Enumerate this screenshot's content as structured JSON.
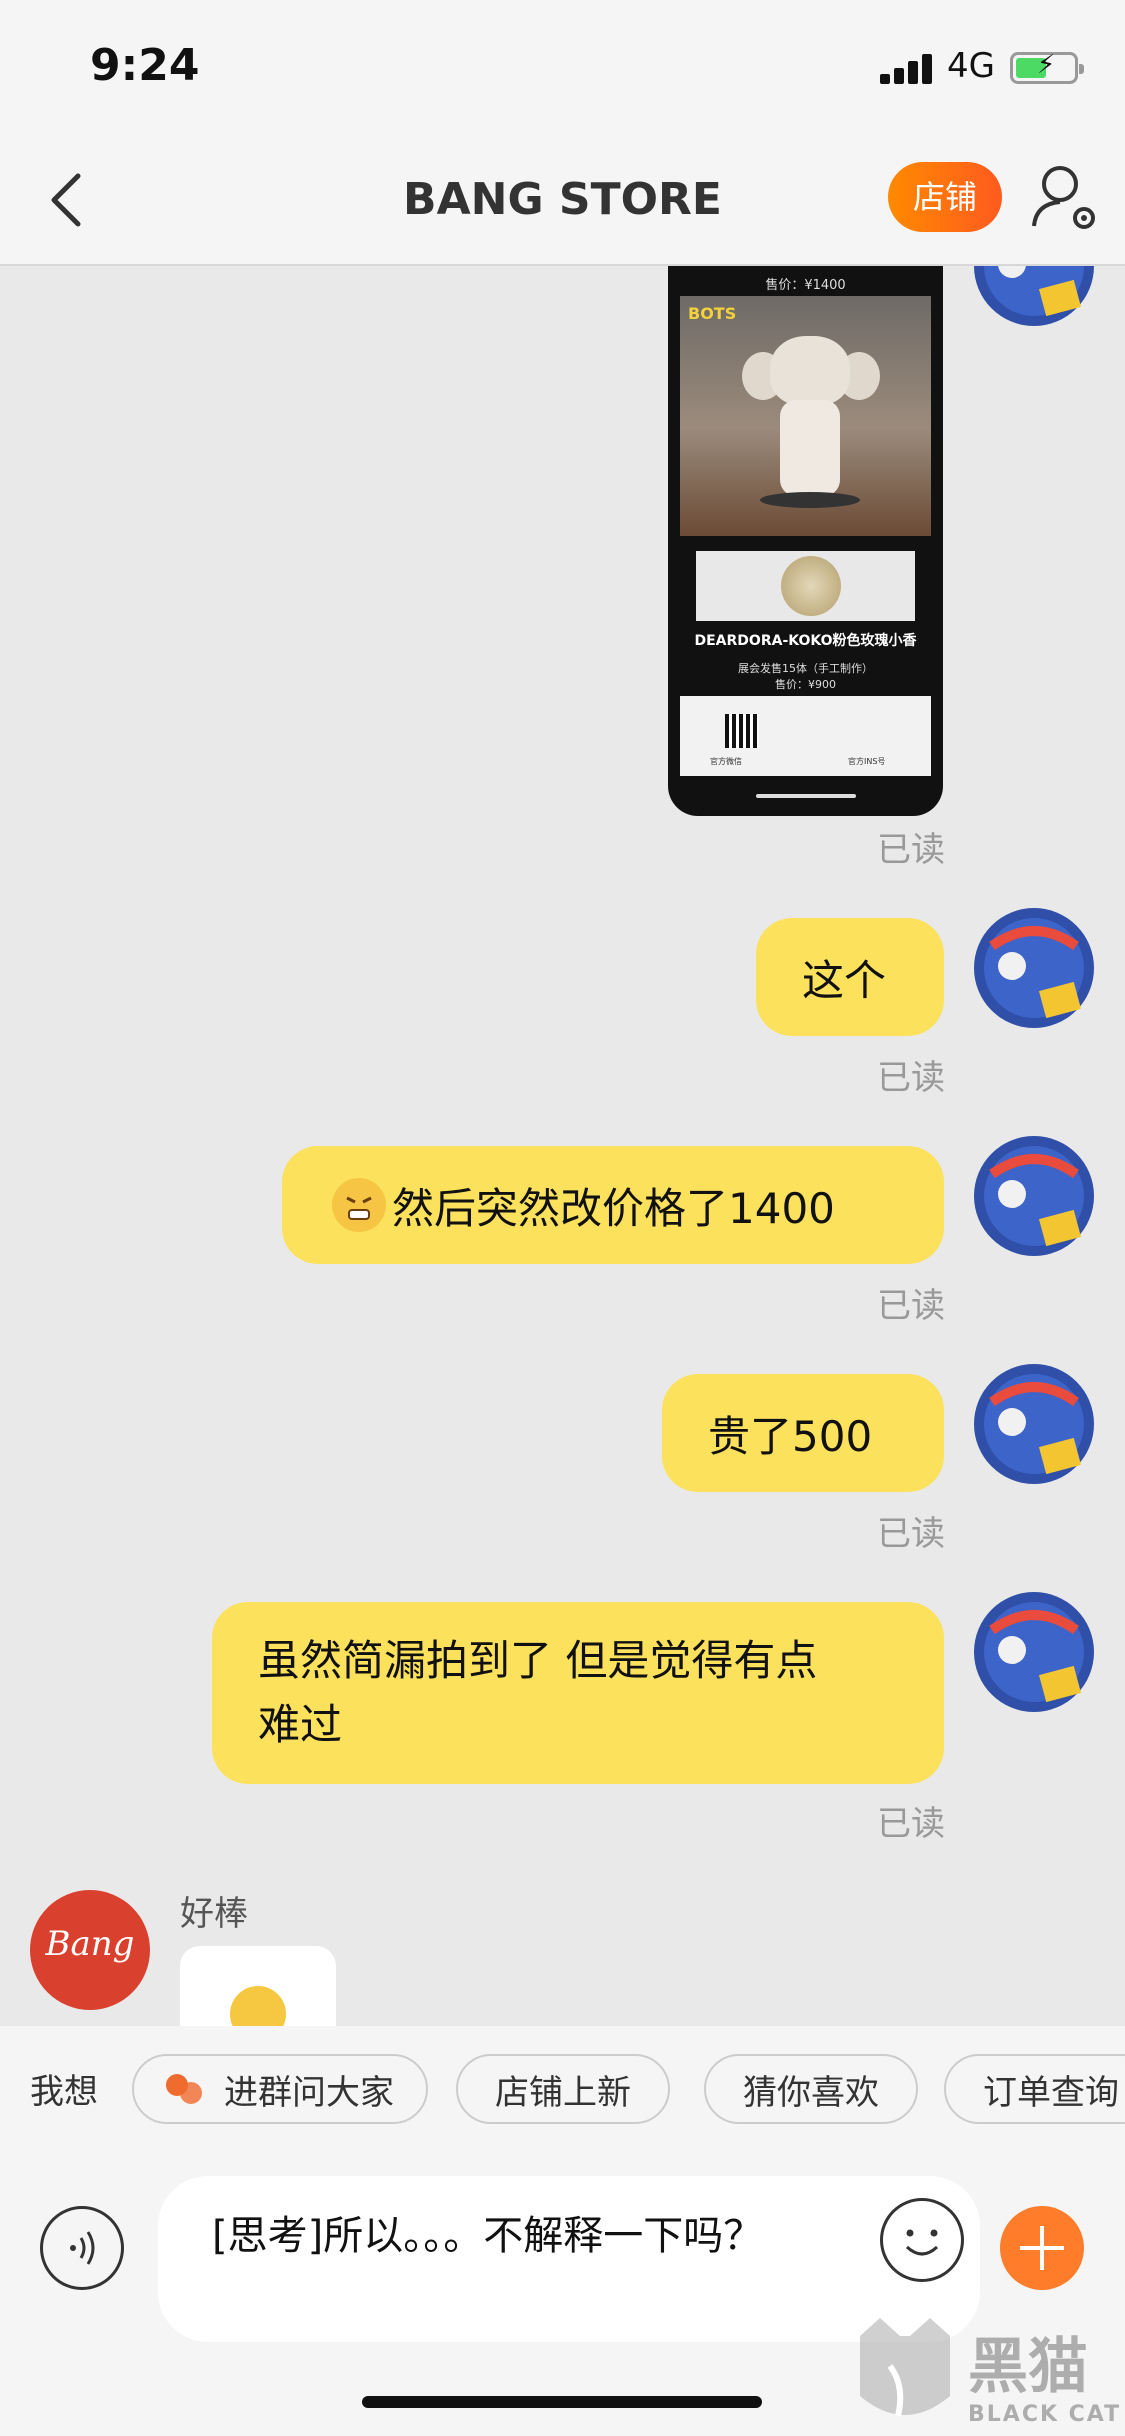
{
  "status_bar": {
    "time": "9:24",
    "network": "4G"
  },
  "nav": {
    "title": "BANG STORE",
    "shop_label": "店铺"
  },
  "shared_image": {
    "price_top": "售价：¥1400",
    "brand": "BOTS",
    "product_name": "DEARDORA-KOKO粉色玫瑰小香",
    "desc_line1": "展会发售15体（手工制作）",
    "desc_line2": "售价：¥900",
    "qr_label_left": "官方微信",
    "qr_label_right": "官方INS号"
  },
  "messages": [
    {
      "text": "这个",
      "status": "已读"
    },
    {
      "text": "然后突然改价格了1400",
      "status": "已读"
    },
    {
      "text": "贵了500",
      "status": "已读"
    },
    {
      "text": "虽然简漏拍到了 但是觉得有点难过",
      "status": "已读"
    }
  ],
  "image_read_status": "已读",
  "merchant": {
    "avatar_text": "Bang",
    "name": "好棒"
  },
  "quick_bar": {
    "label": "我想",
    "chips": [
      "进群问大家",
      "店铺上新",
      "猜你喜欢",
      "订单查询"
    ]
  },
  "input": {
    "value": "[思考]所以。。。不解释一下吗？"
  },
  "watermark": {
    "cn": "黑猫",
    "en": "BLACK CAT"
  },
  "colors": {
    "bubble": "#fbe15c",
    "accent": "#ff7d2a",
    "merchant_avatar": "#d9402e"
  }
}
